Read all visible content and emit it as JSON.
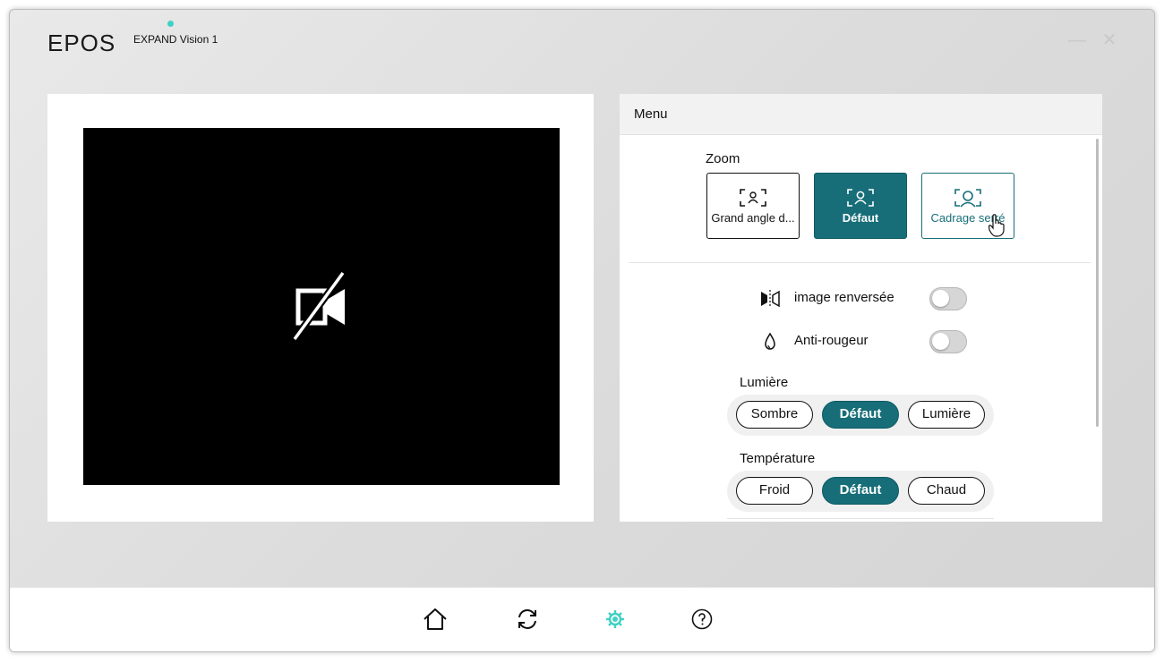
{
  "app": {
    "logo": "EPOS",
    "device_name": "EXPAND Vision 1",
    "accent_color": "#176e78",
    "status_dot_color": "#3fd1c4"
  },
  "window_controls": {
    "minimize": "—",
    "close": "✕"
  },
  "preview": {
    "camera_icon": "camera-off-icon"
  },
  "menu": {
    "title": "Menu",
    "zoom": {
      "label": "Zoom",
      "options": [
        {
          "label": "Grand angle d...",
          "icon": "wide-frame-icon",
          "selected": false
        },
        {
          "label": "Défaut",
          "icon": "default-frame-icon",
          "selected": true
        },
        {
          "label": "Cadrage serré",
          "icon": "tight-frame-icon",
          "selected": false
        }
      ]
    },
    "toggles": [
      {
        "label": "image renversée",
        "icon": "mirror-icon",
        "on": false
      },
      {
        "label": "Anti-rougeur",
        "icon": "drop-icon",
        "on": false
      }
    ],
    "light": {
      "label": "Lumière",
      "options": [
        "Sombre",
        "Défaut",
        "Lumière"
      ],
      "selected": "Défaut"
    },
    "temperature": {
      "label": "Température",
      "options": [
        "Froid",
        "Défaut",
        "Chaud"
      ],
      "selected": "Défaut"
    }
  },
  "bottom_nav": [
    {
      "icon": "home-icon"
    },
    {
      "icon": "sync-icon"
    },
    {
      "icon": "settings-icon",
      "active": true
    },
    {
      "icon": "help-icon"
    }
  ]
}
